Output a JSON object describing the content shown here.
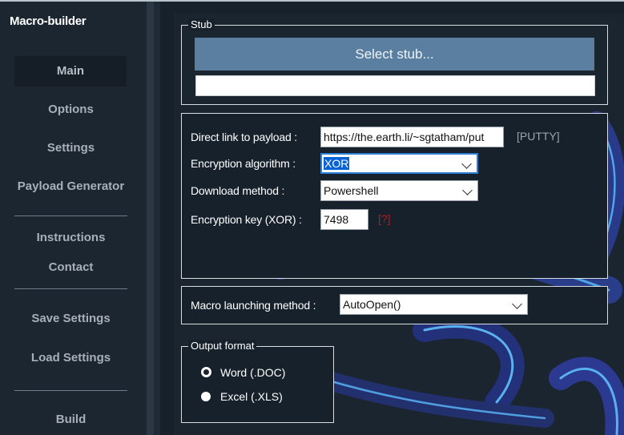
{
  "sidebar": {
    "app_title": "Macro-builder",
    "items": [
      {
        "label": "Main"
      },
      {
        "label": "Options"
      },
      {
        "label": "Settings"
      },
      {
        "label": "Payload Generator"
      },
      {
        "label": "Instructions"
      },
      {
        "label": "Contact"
      },
      {
        "label": "Save Settings"
      },
      {
        "label": "Load Settings"
      },
      {
        "label": "Build"
      }
    ],
    "active_item": "Main"
  },
  "stub": {
    "legend": "Stub",
    "select_button_label": "Select stub...",
    "path_value": ""
  },
  "payload": {
    "direct_link_label": "Direct link to payload :",
    "direct_link_value": "https://the.earth.li/~sgtatham/put",
    "direct_link_tag": "[PUTTY]",
    "encryption_algorithm_label": "Encryption algorithm :",
    "encryption_algorithm_value": "XOR",
    "download_method_label": "Download method :",
    "download_method_value": "Powershell",
    "encryption_key_label": "Encryption key (XOR) :",
    "encryption_key_value": "7498",
    "encryption_key_help": "[?]"
  },
  "macro": {
    "launch_method_label": "Macro launching method :",
    "launch_method_value": "AutoOpen()"
  },
  "output_format": {
    "legend": "Output format",
    "options": [
      {
        "label": "Word (.DOC)",
        "checked": true
      },
      {
        "label": "Excel (.XLS)",
        "checked": false
      }
    ]
  },
  "colors": {
    "accent_button": "#5b7fa0",
    "focus_border": "#2d7fd6",
    "help_red": "#c0161d",
    "background": "#1a2430"
  }
}
